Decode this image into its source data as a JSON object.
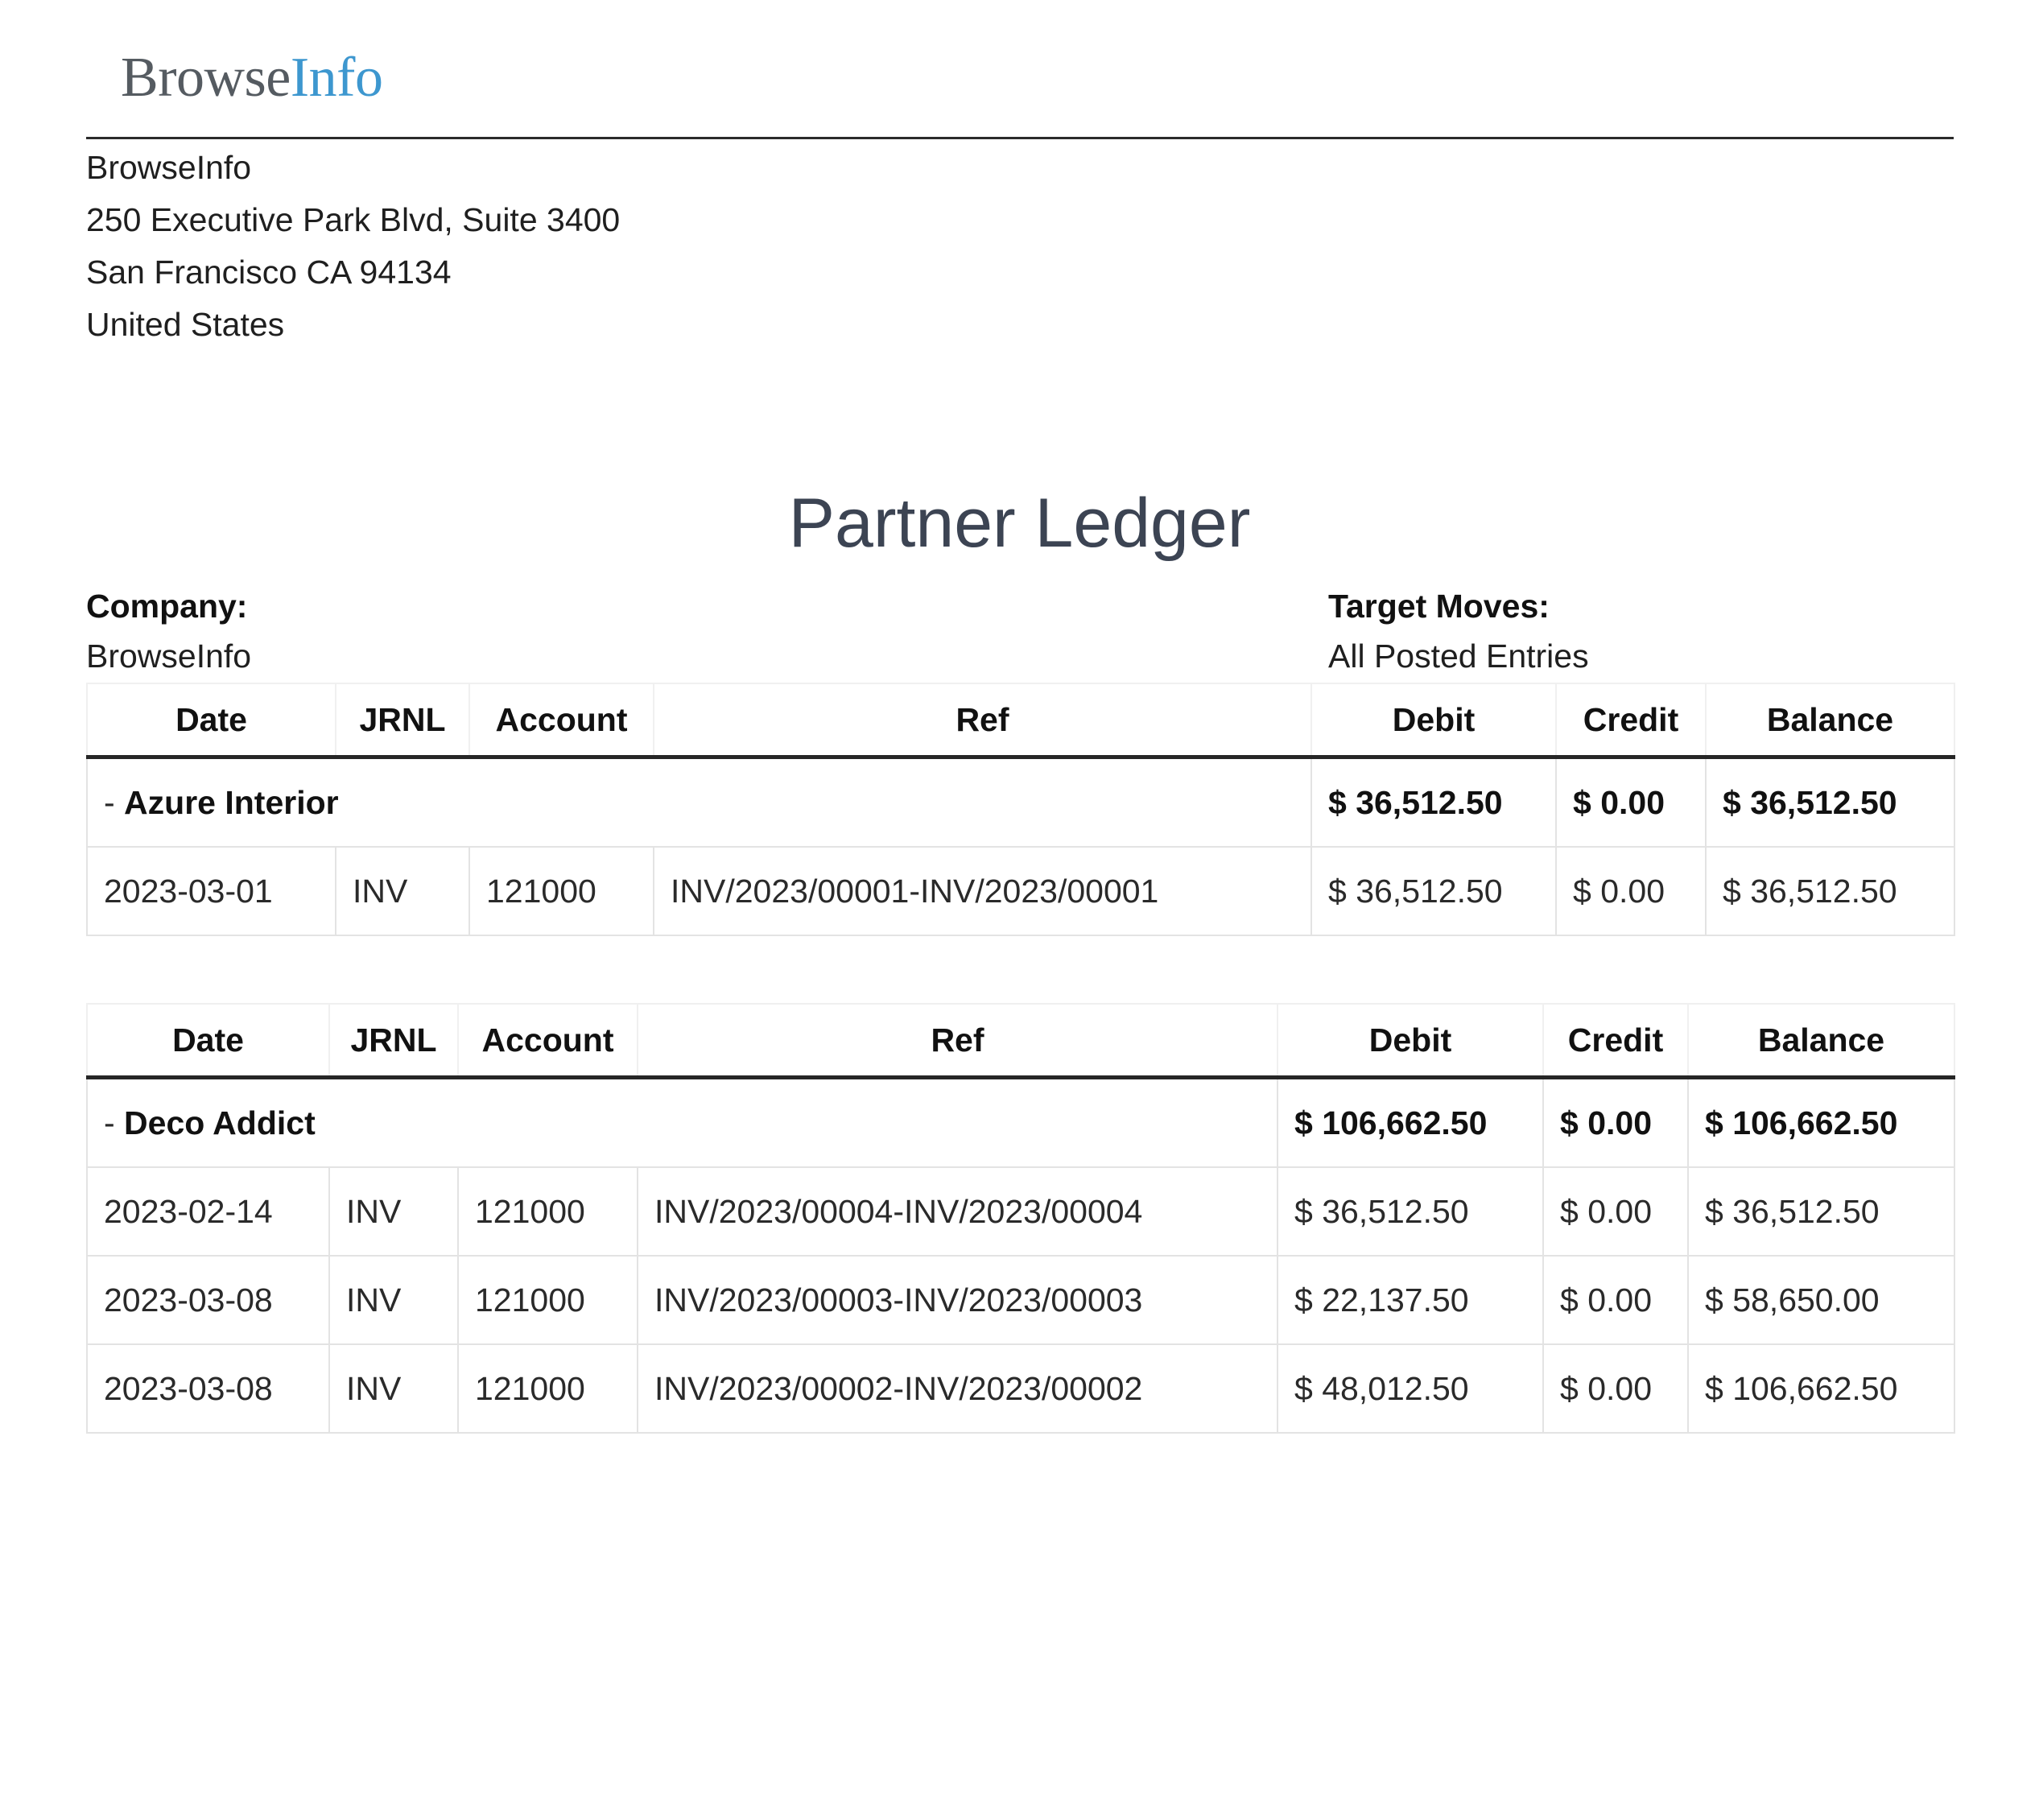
{
  "logo": {
    "part1": "Browse",
    "part2": "Info"
  },
  "company_address": {
    "name": "BrowseInfo",
    "line1": "250 Executive Park Blvd, Suite 3400",
    "line2": "San Francisco CA 94134",
    "country": "United States"
  },
  "report": {
    "title": "Partner Ledger",
    "company_label": "Company:",
    "company_value": "BrowseInfo",
    "target_label": "Target Moves:",
    "target_value": "All Posted Entries"
  },
  "columns": {
    "date": "Date",
    "jrnl": "JRNL",
    "account": "Account",
    "ref": "Ref",
    "debit": "Debit",
    "credit": "Credit",
    "balance": "Balance"
  },
  "partners": [
    {
      "dash": "- ",
      "name": "Azure Interior",
      "debit": "$ 36,512.50",
      "credit": "$ 0.00",
      "balance": "$ 36,512.50",
      "lines": [
        {
          "date": "2023-03-01",
          "jrnl": "INV",
          "account": "121000",
          "ref": "INV/2023/00001-INV/2023/00001",
          "debit": "$ 36,512.50",
          "credit": "$ 0.00",
          "balance": "$ 36,512.50"
        }
      ]
    },
    {
      "dash": "- ",
      "name": "Deco Addict",
      "debit": "$ 106,662.50",
      "credit": "$ 0.00",
      "balance": "$ 106,662.50",
      "lines": [
        {
          "date": "2023-02-14",
          "jrnl": "INV",
          "account": "121000",
          "ref": "INV/2023/00004-INV/2023/00004",
          "debit": "$ 36,512.50",
          "credit": "$ 0.00",
          "balance": "$ 36,512.50"
        },
        {
          "date": "2023-03-08",
          "jrnl": "INV",
          "account": "121000",
          "ref": "INV/2023/00003-INV/2023/00003",
          "debit": "$ 22,137.50",
          "credit": "$ 0.00",
          "balance": "$ 58,650.00"
        },
        {
          "date": "2023-03-08",
          "jrnl": "INV",
          "account": "121000",
          "ref": "INV/2023/00002-INV/2023/00002",
          "debit": "$ 48,012.50",
          "credit": "$ 0.00",
          "balance": "$ 106,662.50"
        }
      ]
    }
  ]
}
